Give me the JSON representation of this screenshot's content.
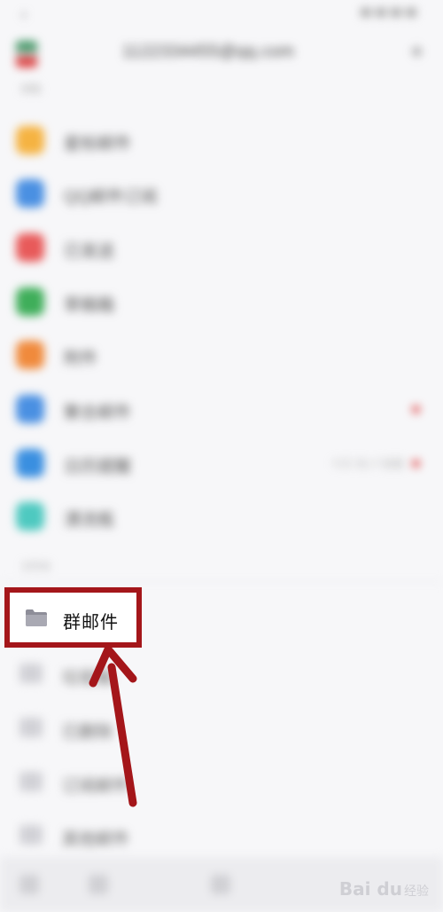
{
  "account": {
    "email": "1122334455@qq.com"
  },
  "sections": {
    "mailbox_label": "邮箱",
    "folders_label": "文件夹"
  },
  "menu": [
    {
      "label": "星标邮件",
      "color": "#f5b342"
    },
    {
      "label": "QQ邮件订阅",
      "color": "#4a90e2"
    },
    {
      "label": "已发送",
      "color": "#e85a5a"
    },
    {
      "label": "草稿箱",
      "color": "#3fae5a"
    },
    {
      "label": "附件",
      "color": "#f08a3c"
    },
    {
      "label": "聚合邮件",
      "color": "#4a90e2"
    },
    {
      "label": "日历提醒",
      "color": "#3a8fe0",
      "sub": "今天 有1个提醒"
    },
    {
      "label": "漂流瓶",
      "color": "#4ec9c0"
    }
  ],
  "folders": [
    {
      "label": "群邮件"
    },
    {
      "label": "垃圾箱"
    },
    {
      "label": "已删除"
    },
    {
      "label": "订阅邮件"
    },
    {
      "label": "其他邮件"
    }
  ],
  "highlight": {
    "label": "群邮件",
    "border_color": "#a4161a"
  },
  "watermark": {
    "text": "Bai du",
    "sub": "经验"
  }
}
